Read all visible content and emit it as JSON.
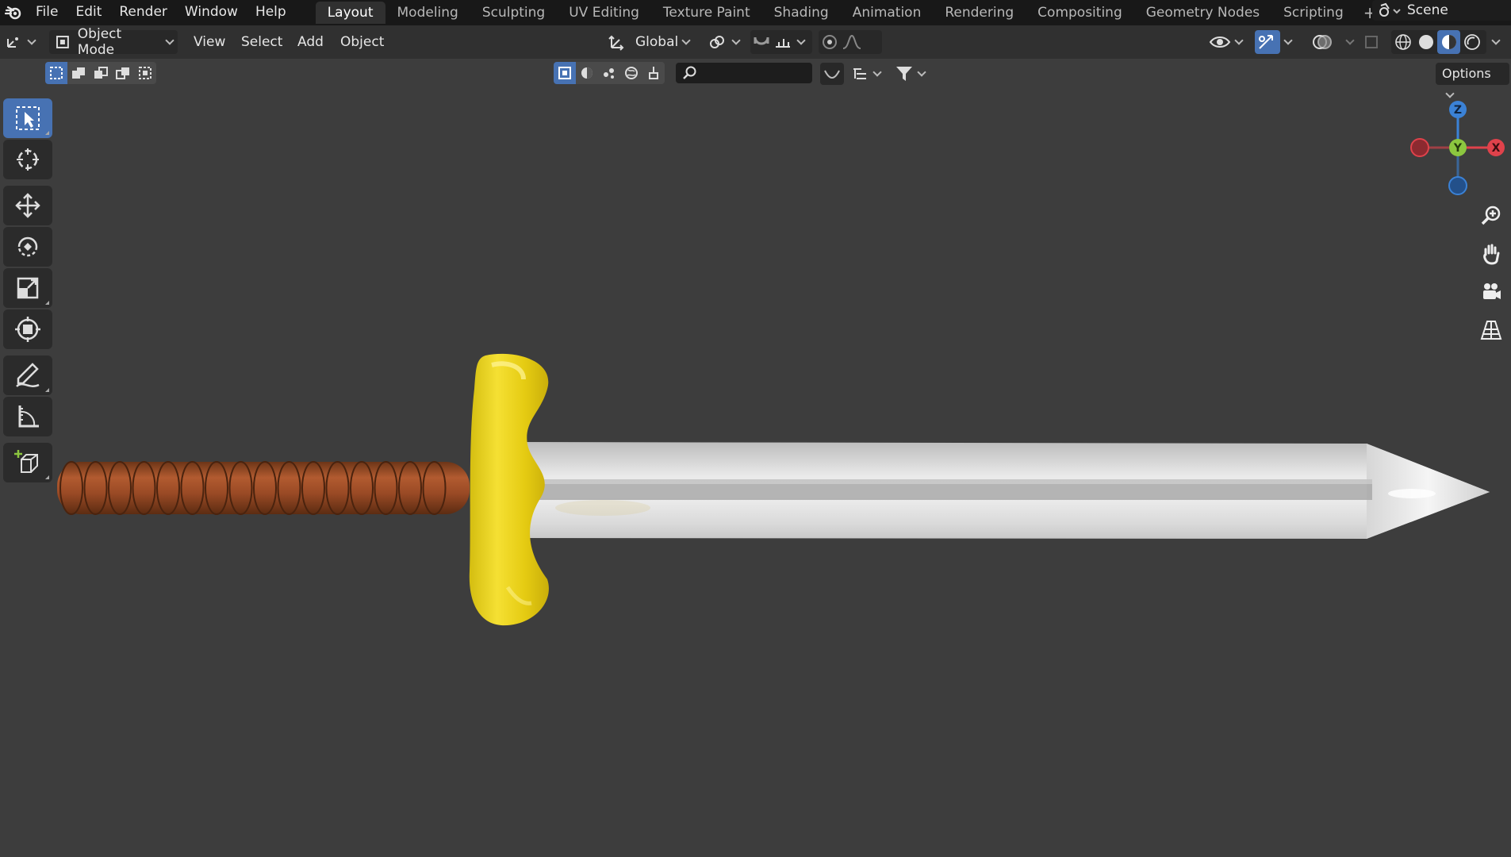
{
  "menubar": {
    "menus": [
      "File",
      "Edit",
      "Render",
      "Window",
      "Help"
    ],
    "workspaces": [
      "Layout",
      "Modeling",
      "Sculpting",
      "UV Editing",
      "Texture Paint",
      "Shading",
      "Animation",
      "Rendering",
      "Compositing",
      "Geometry Nodes",
      "Scripting"
    ],
    "active_workspace": "Layout",
    "add_tab": "+",
    "scene": "Scene"
  },
  "header": {
    "mode": "Object Mode",
    "menus": [
      "View",
      "Select",
      "Add",
      "Object"
    ],
    "orientation": "Global"
  },
  "toolsettings": {
    "options_label": "Options",
    "search_placeholder": ""
  },
  "left_tools": [
    "select-box",
    "cursor",
    "move",
    "rotate",
    "scale",
    "transform",
    "annotate",
    "measure",
    "add-cube"
  ],
  "active_tool": "select-box",
  "gizmo": {
    "z": "Z",
    "y": "Y",
    "x": "X"
  },
  "colors": {
    "accent": "#4772b3",
    "background": "#3d3d3d",
    "axis_x": "#e0424b",
    "axis_y": "#8cc63f",
    "axis_z": "#3b82d6",
    "guard": "#f2d91a",
    "grip": "#9a4a25",
    "blade": "#d8d8d8"
  }
}
